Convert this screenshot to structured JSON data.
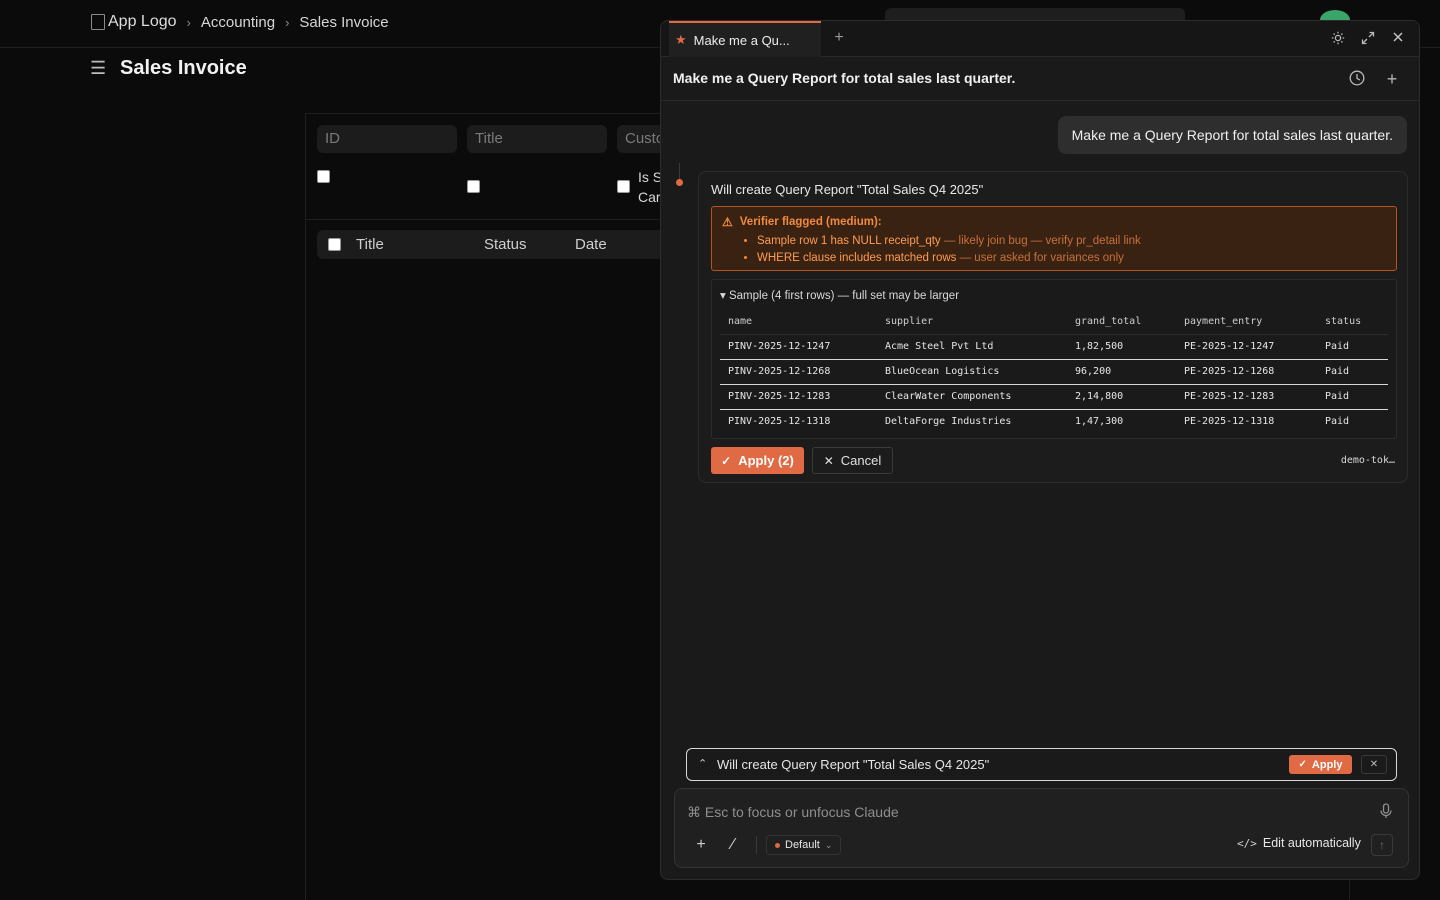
{
  "app": {
    "logo_alt": "App Logo",
    "breadcrumb": [
      "Accounting",
      "Sales Invoice"
    ],
    "page_title": "Sales Invoice",
    "filters": {
      "id_placeholder": "ID",
      "title_placeholder": "Title",
      "customer_placeholder": "Custo",
      "is_label_line1": "Is S",
      "is_label_line2": "Car"
    },
    "columns": [
      "Title",
      "Status",
      "Date"
    ]
  },
  "panel": {
    "tab_label": "Make me a Qu...",
    "conversation_title": "Make me a Query Report for total sales last quarter.",
    "user_message": "Make me a Query Report for total sales last quarter.",
    "response": {
      "title": "Will create Query Report \"Total Sales Q4 2025\"",
      "verifier_heading": "Verifier flagged (medium):",
      "verifier_items": [
        {
          "strong": "Sample row 1 has NULL receipt_qty",
          "soft": " — likely join bug — verify pr_detail link"
        },
        {
          "strong": "WHERE clause includes matched rows",
          "soft": " — user asked for variances only"
        }
      ],
      "sample_summary": "▾ Sample (4 first rows) — full set may be larger",
      "table": {
        "headers": [
          "name",
          "supplier",
          "grand_total",
          "payment_entry",
          "status"
        ],
        "rows": [
          [
            "PINV-2025-12-1247",
            "Acme Steel Pvt Ltd",
            "1,82,500",
            "PE-2025-12-1247",
            "Paid"
          ],
          [
            "PINV-2025-12-1268",
            "BlueOcean Logistics",
            "96,200",
            "PE-2025-12-1268",
            "Paid"
          ],
          [
            "PINV-2025-12-1283",
            "ClearWater Components",
            "2,14,800",
            "PE-2025-12-1283",
            "Paid"
          ],
          [
            "PINV-2025-12-1318",
            "DeltaForge Industries",
            "1,47,300",
            "PE-2025-12-1318",
            "Paid"
          ]
        ]
      },
      "apply_label": "Apply (2)",
      "cancel_label": "Cancel",
      "token_label": "demo-tok…"
    },
    "pending": {
      "text": "Will create Query Report \"Total Sales Q4 2025\"",
      "apply_label": "Apply"
    },
    "composer": {
      "placeholder": "⌘ Esc to focus or unfocus Claude",
      "model": "Default",
      "edit_mode": "Edit automatically"
    }
  },
  "colors": {
    "accent": "#e06a44",
    "warning": "#f08a3c",
    "background": "#0b0b0b",
    "panel": "#1a1a1a"
  },
  "icons": [
    "hamburger-icon",
    "chevron-right-icon",
    "star-icon",
    "plus-icon",
    "sun-icon",
    "expand-icon",
    "close-icon",
    "history-icon",
    "warning-icon",
    "check-icon",
    "chevron-up-icon",
    "mic-icon",
    "slash-icon",
    "code-icon",
    "arrow-up-icon"
  ]
}
